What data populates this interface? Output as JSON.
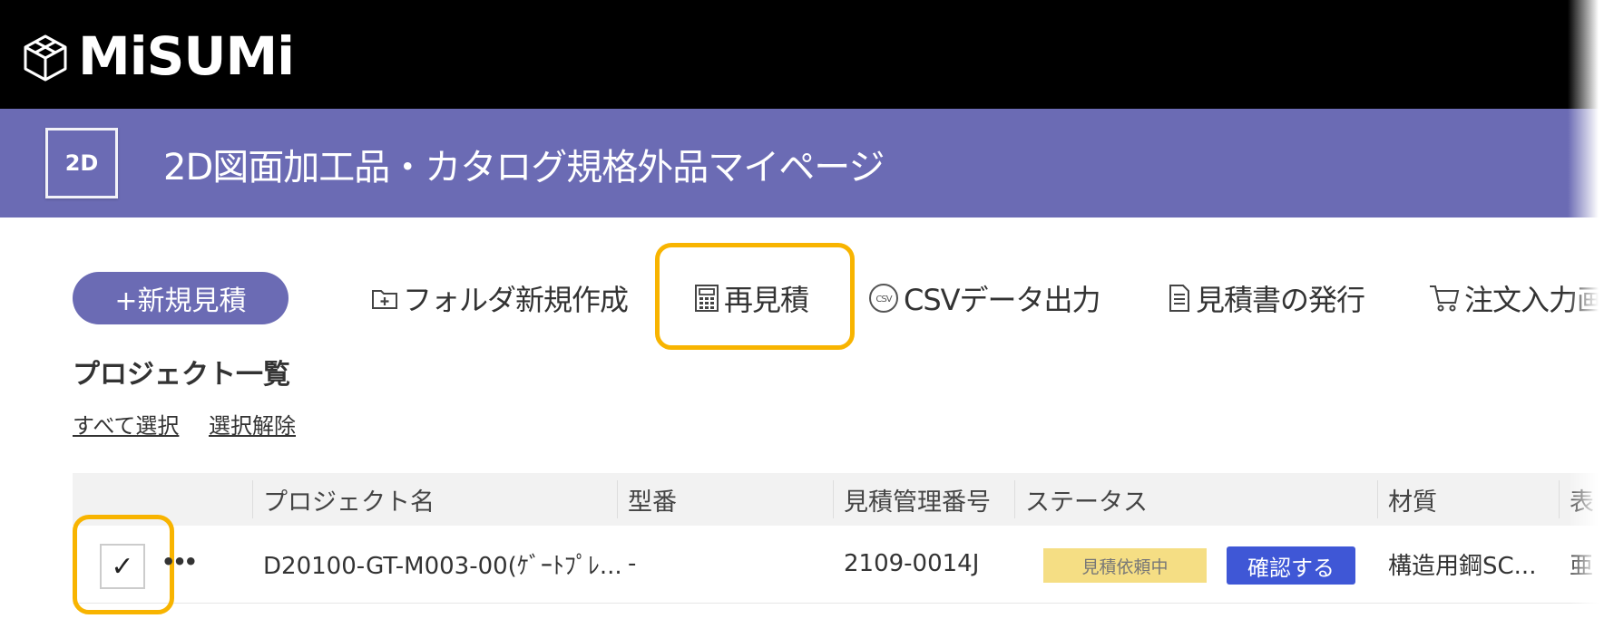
{
  "brand": {
    "logo_text": "MiSUMi",
    "logo_icon": "cube-outline-icon"
  },
  "title_bar": {
    "badge": "2D",
    "title": "2D図面加工品・カタログ規格外品マイページ"
  },
  "toolbar": {
    "new_quote_label": "+新規見積",
    "folder_label": "フォルダ新規作成",
    "requote_label": "再見積",
    "csv_label": "CSVデータ出力",
    "issue_label": "見積書の発行",
    "order_label": "注文入力画"
  },
  "list": {
    "title": "プロジェクト一覧",
    "select_all": "すべて選択",
    "deselect": "選択解除"
  },
  "table": {
    "headers": [
      "プロジェクト名",
      "型番",
      "見積管理番号",
      "ステータス",
      "材質",
      "表"
    ],
    "rows": [
      {
        "checked": true,
        "checkmark": "✓",
        "more": "•••",
        "project_name": "D20100-GT-M003-00(ｹﾞｰﾄﾌﾟﾚ...",
        "part_number": "-",
        "quote_number": "2109-0014J",
        "status": "見積依頼中",
        "action": "確認する",
        "material": "構造用鋼SC...",
        "surface": "亜"
      }
    ]
  },
  "colors": {
    "brand_purple": "#6b6bb4",
    "highlight": "#f8b400",
    "confirm": "#3f57d6",
    "status_pill": "#f5de84"
  }
}
